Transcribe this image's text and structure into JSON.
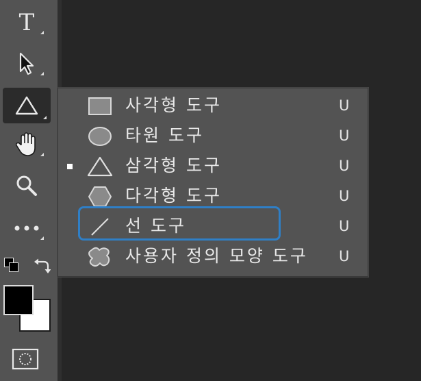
{
  "toolbar": {
    "tools": [
      {
        "name": "text-tool",
        "icon": "T"
      },
      {
        "name": "path-selection-tool",
        "icon": "arrow-icon"
      },
      {
        "name": "shape-tool",
        "icon": "triangle-icon",
        "active": true
      },
      {
        "name": "hand-tool",
        "icon": "hand-icon"
      },
      {
        "name": "zoom-tool",
        "icon": "magnifier-icon"
      },
      {
        "name": "more-tools",
        "icon": "ellipsis-icon"
      }
    ],
    "colors": {
      "foreground": "#000000",
      "background": "#ffffff"
    }
  },
  "flyout": {
    "items": [
      {
        "label": "사각형 도구",
        "shortcut": "U",
        "icon": "rectangle-icon",
        "selected": false
      },
      {
        "label": "타원 도구",
        "shortcut": "U",
        "icon": "ellipse-icon",
        "selected": false
      },
      {
        "label": "삼각형 도구",
        "shortcut": "U",
        "icon": "triangle-icon",
        "selected": true
      },
      {
        "label": "다각형 도구",
        "shortcut": "U",
        "icon": "polygon-icon",
        "selected": false
      },
      {
        "label": "선 도구",
        "shortcut": "U",
        "icon": "line-icon",
        "selected": false
      },
      {
        "label": "사용자 정의 모양 도구",
        "shortcut": "U",
        "icon": "custom-shape-icon",
        "selected": false
      }
    ]
  },
  "accent": "#2f7fc6"
}
